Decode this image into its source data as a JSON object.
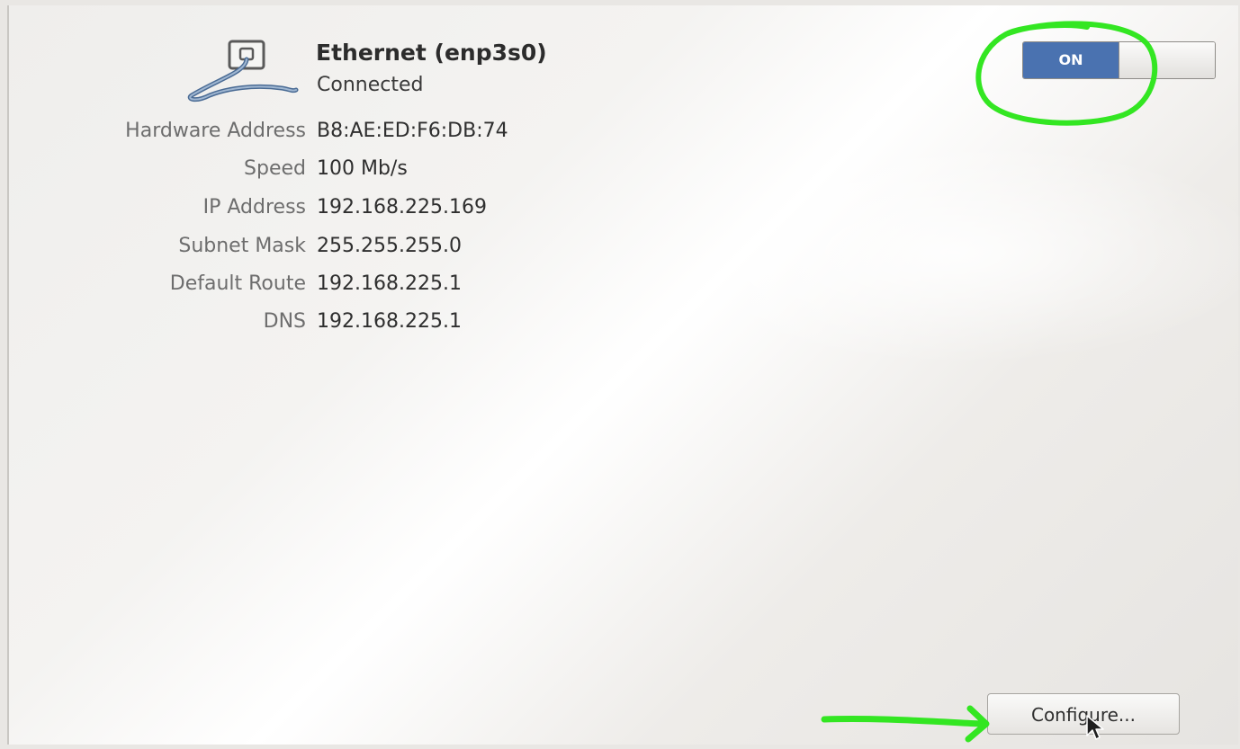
{
  "connection": {
    "title": "Ethernet (enp3s0)",
    "status": "Connected",
    "icon": "ethernet-cable-icon"
  },
  "details": [
    {
      "label": "Hardware Address",
      "value": "B8:AE:ED:F6:DB:74"
    },
    {
      "label": "Speed",
      "value": "100 Mb/s"
    },
    {
      "label": "IP Address",
      "value": "192.168.225.169"
    },
    {
      "label": "Subnet Mask",
      "value": "255.255.255.0"
    },
    {
      "label": "Default Route",
      "value": "192.168.225.1"
    },
    {
      "label": "DNS",
      "value": "192.168.225.1"
    }
  ],
  "toggle": {
    "label": "ON",
    "state": "on",
    "color": "#4a72b0"
  },
  "configure_button": {
    "label": "Configure..."
  },
  "annotations": {
    "highlight_color": "#33e622",
    "circle_target": "power-toggle",
    "arrow_target": "configure-button"
  }
}
